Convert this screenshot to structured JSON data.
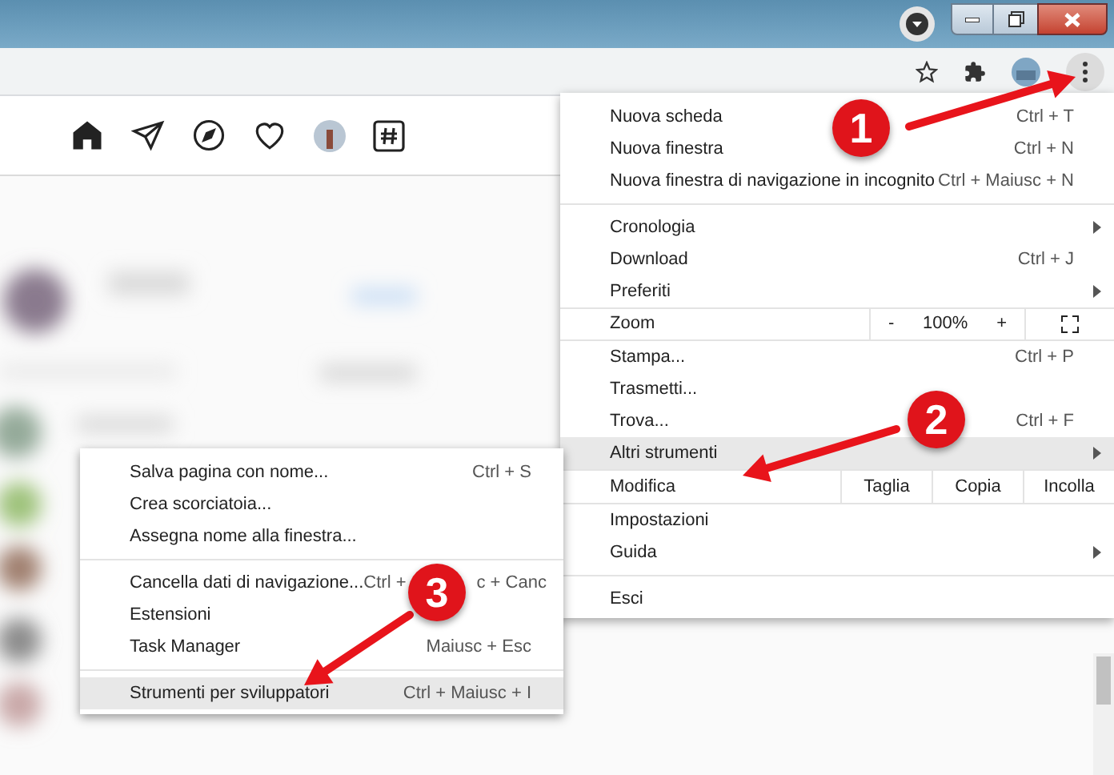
{
  "menu": {
    "sections": [
      [
        {
          "kind": "item",
          "label": "Nuova scheda",
          "shortcut": "Ctrl + T",
          "has_submenu": false,
          "selected": false
        },
        {
          "kind": "item",
          "label": "Nuova finestra",
          "shortcut": "Ctrl + N",
          "has_submenu": false,
          "selected": false
        },
        {
          "kind": "item",
          "label": "Nuova finestra di navigazione in incognito",
          "shortcut": "Ctrl + Maiusc + N",
          "has_submenu": false,
          "selected": false
        }
      ],
      [
        {
          "kind": "item",
          "label": "Cronologia",
          "has_submenu": true,
          "selected": false
        },
        {
          "kind": "item",
          "label": "Download",
          "shortcut": "Ctrl + J",
          "has_submenu": false,
          "selected": false
        },
        {
          "kind": "item",
          "label": "Preferiti",
          "has_submenu": true,
          "selected": false
        }
      ],
      [
        {
          "kind": "zoom",
          "label": "Zoom",
          "minus": "-",
          "value": "100%",
          "plus": "+"
        }
      ],
      [
        {
          "kind": "item",
          "label": "Stampa...",
          "shortcut": "Ctrl + P",
          "has_submenu": false,
          "selected": false
        },
        {
          "kind": "item",
          "label": "Trasmetti...",
          "has_submenu": false,
          "selected": false
        },
        {
          "kind": "item",
          "label": "Trova...",
          "shortcut": "Ctrl + F",
          "has_submenu": false,
          "selected": false
        },
        {
          "kind": "item",
          "label": "Altri strumenti",
          "has_submenu": true,
          "selected": true
        }
      ],
      [
        {
          "kind": "edit",
          "label": "Modifica",
          "buttons": [
            "Taglia",
            "Copia",
            "Incolla"
          ]
        }
      ],
      [
        {
          "kind": "item",
          "label": "Impostazioni",
          "has_submenu": false,
          "selected": false
        },
        {
          "kind": "item",
          "label": "Guida",
          "has_submenu": true,
          "selected": false
        }
      ],
      [
        {
          "kind": "item",
          "label": "Esci",
          "has_submenu": false,
          "selected": false
        }
      ]
    ]
  },
  "submenu": {
    "sections": [
      [
        {
          "label": "Salva pagina con nome...",
          "shortcut": "Ctrl + S",
          "selected": false
        },
        {
          "label": "Crea scorciatoia...",
          "selected": false
        },
        {
          "label": "Assegna nome alla finestra...",
          "selected": false
        }
      ],
      [
        {
          "label": "Cancella dati di navigazione...",
          "shortcut": "Ctrl +",
          "shortcut_end": "c + Canc",
          "selected": false
        },
        {
          "label": "Estensioni",
          "selected": false
        },
        {
          "label": "Task Manager",
          "shortcut": "Maiusc + Esc",
          "selected": false
        }
      ],
      [
        {
          "label": "Strumenti per sviluppatori",
          "shortcut": "Ctrl + Maiusc + I",
          "selected": true
        }
      ]
    ]
  },
  "annotations": [
    {
      "label": "1"
    },
    {
      "label": "2"
    },
    {
      "label": "3"
    }
  ]
}
